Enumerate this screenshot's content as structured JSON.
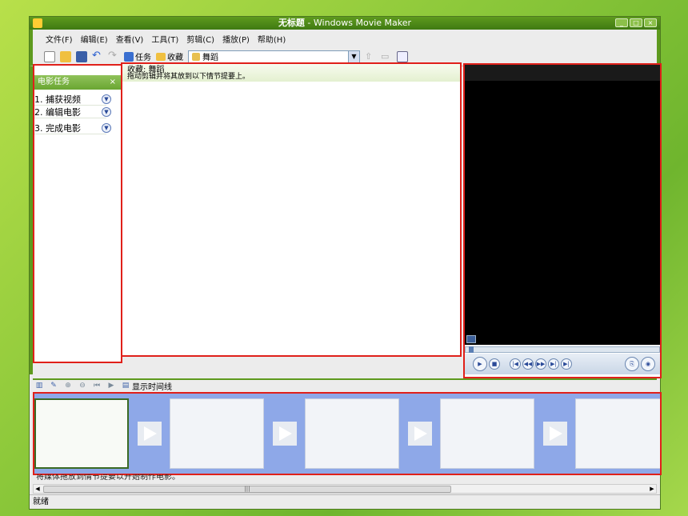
{
  "window": {
    "title_doc": "无标题",
    "title_app": " - Windows Movie Maker"
  },
  "menu": [
    "文件(F)",
    "编辑(E)",
    "查看(V)",
    "工具(T)",
    "剪辑(C)",
    "播放(P)",
    "帮助(H)"
  ],
  "toolbar": {
    "tasks_label": "任务",
    "collections_label": "收藏",
    "collection_value": "舞蹈"
  },
  "task_pane": {
    "header": "电影任务",
    "close": "×",
    "items": [
      "1. 捕获视频",
      "2. 编辑电影",
      "3. 完成电影"
    ]
  },
  "collection": {
    "title": "收藏: 舞蹈",
    "subtitle": "拖动剪辑并将其放到以下情节提要上。"
  },
  "storyboard": {
    "show_timeline_label": "显示时间线",
    "hint": "将媒体拖放到情节提要以开始制作电影。"
  },
  "status": {
    "text": "就绪"
  },
  "colors": {
    "highlight": "#e0201a",
    "frame_green": "#5e9a1e",
    "storyboard_bg": "#8ea8e8"
  }
}
